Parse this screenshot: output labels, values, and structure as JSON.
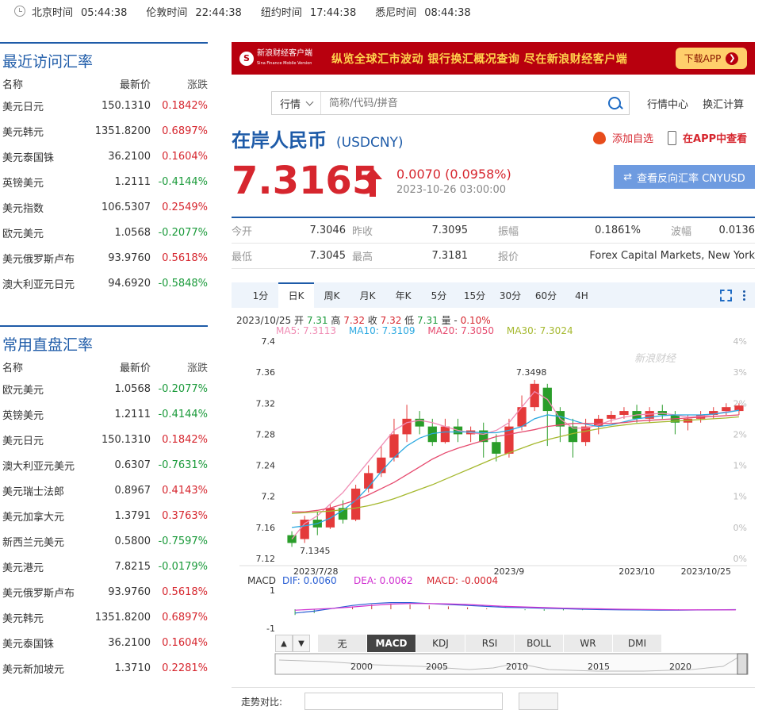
{
  "clocks": [
    {
      "city": "北京时间",
      "time": "05:44:38"
    },
    {
      "city": "伦敦时间",
      "time": "22:44:38"
    },
    {
      "city": "纽约时间",
      "time": "17:44:38"
    },
    {
      "city": "悉尼时间",
      "time": "08:44:38"
    }
  ],
  "recent": {
    "title": "最近访问汇率",
    "header": {
      "name": "名称",
      "price": "最新价",
      "change": "涨跌"
    },
    "rows": [
      {
        "name": "美元日元",
        "price": "150.1310",
        "change": "0.1842%",
        "dir": "up"
      },
      {
        "name": "美元韩元",
        "price": "1351.8200",
        "change": "0.6897%",
        "dir": "up"
      },
      {
        "name": "美元泰国铢",
        "price": "36.2100",
        "change": "0.1604%",
        "dir": "up"
      },
      {
        "name": "英镑美元",
        "price": "1.2111",
        "change": "-0.4144%",
        "dir": "down"
      },
      {
        "name": "美元指数",
        "price": "106.5307",
        "change": "0.2549%",
        "dir": "up"
      },
      {
        "name": "欧元美元",
        "price": "1.0568",
        "change": "-0.2077%",
        "dir": "down"
      },
      {
        "name": "美元俄罗斯卢布",
        "price": "93.9760",
        "change": "0.5618%",
        "dir": "up"
      },
      {
        "name": "澳大利亚元日元",
        "price": "94.6920",
        "change": "-0.5848%",
        "dir": "down"
      }
    ]
  },
  "common": {
    "title": "常用直盘汇率",
    "header": {
      "name": "名称",
      "price": "最新价",
      "change": "涨跌"
    },
    "rows": [
      {
        "name": "欧元美元",
        "price": "1.0568",
        "change": "-0.2077%",
        "dir": "down"
      },
      {
        "name": "英镑美元",
        "price": "1.2111",
        "change": "-0.4144%",
        "dir": "down"
      },
      {
        "name": "美元日元",
        "price": "150.1310",
        "change": "0.1842%",
        "dir": "up"
      },
      {
        "name": "澳大利亚元美元",
        "price": "0.6307",
        "change": "-0.7631%",
        "dir": "down"
      },
      {
        "name": "美元瑞士法郎",
        "price": "0.8967",
        "change": "0.4143%",
        "dir": "up"
      },
      {
        "name": "美元加拿大元",
        "price": "1.3791",
        "change": "0.3763%",
        "dir": "up"
      },
      {
        "name": "新西兰元美元",
        "price": "0.5800",
        "change": "-0.7597%",
        "dir": "down"
      },
      {
        "name": "美元港元",
        "price": "7.8215",
        "change": "-0.0179%",
        "dir": "down"
      },
      {
        "name": "美元俄罗斯卢布",
        "price": "93.9760",
        "change": "0.5618%",
        "dir": "up"
      },
      {
        "name": "美元韩元",
        "price": "1351.8200",
        "change": "0.6897%",
        "dir": "up"
      },
      {
        "name": "美元泰国铢",
        "price": "36.2100",
        "change": "0.1604%",
        "dir": "up"
      },
      {
        "name": "美元新加坡元",
        "price": "1.3710",
        "change": "0.2281%",
        "dir": "up"
      }
    ]
  },
  "banner": {
    "logo_text": "新浪财经客户端",
    "logo_sub": "Sina Finance Mobile Version",
    "slogan": "纵览全球汇市波动  银行换汇概况查询  尽在新浪财经客户端",
    "download": "下载APP"
  },
  "search": {
    "select": "行情",
    "placeholder": "简称/代码/拼音"
  },
  "toplinks": [
    "行情中心",
    "换汇计算"
  ],
  "symbol": {
    "name": "在岸人民币",
    "code": "(USDCNY)"
  },
  "actions": {
    "watch": "添加自选",
    "app": "在APP中查看"
  },
  "quote": {
    "price": "7.3165",
    "change": "0.0070 (0.0958%)",
    "time": "2023-10-26 03:00:00",
    "reverse_btn": "查看反向汇率 CNYUSD",
    "up_color": "#d6262e"
  },
  "stats": {
    "open_label": "今开",
    "open": "7.3046",
    "prev_label": "昨收",
    "prev": "7.3095",
    "amp_label": "振幅",
    "amp": "0.1861%",
    "wave_label": "波幅",
    "wave": "0.0136",
    "low_label": "最低",
    "low": "7.3045",
    "high_label": "最高",
    "high": "7.3181",
    "source_label": "报价",
    "source": "Forex Capital Markets, New York"
  },
  "period_tabs": [
    "1分",
    "日K",
    "周K",
    "月K",
    "年K",
    "5分",
    "15分",
    "30分",
    "60分",
    "4H"
  ],
  "active_period": "日K",
  "chart_info": {
    "date": "2023/10/25",
    "open_label": "开",
    "open": "7.31",
    "high_label": "高",
    "high": "7.32",
    "close_label": "收",
    "close": "7.32",
    "low_label": "低",
    "low": "7.31",
    "vol_label": "量",
    "vol": "-",
    "pct": "0.10%"
  },
  "ma_info": [
    {
      "label": "MA5: 7.3113",
      "color": "#f08cb4"
    },
    {
      "label": "MA10: 7.3109",
      "color": "#2aa8e0"
    },
    {
      "label": "MA20: 7.3050",
      "color": "#e64a6e"
    },
    {
      "label": "MA30: 7.3024",
      "color": "#a5b82e"
    }
  ],
  "macd_info": {
    "label": "MACD",
    "dif": "DIF: 0.0060",
    "dea": "DEA: 0.0062",
    "macd": "MACD: -0.0004"
  },
  "indicator_tabs": [
    "无",
    "MACD",
    "KDJ",
    "RSI",
    "BOLL",
    "WR",
    "DMI"
  ],
  "active_indicator": "MACD",
  "navigator_years": [
    "2000",
    "2005",
    "2010",
    "2015",
    "2020"
  ],
  "bottom": {
    "label": "走势对比:",
    "placeholder": "简称/代码/拼音",
    "button": "比较"
  },
  "chart_data": {
    "type": "candlestick",
    "title": "在岸人民币 (USDCNY)",
    "y_ticks": [
      "7.4",
      "7.36",
      "7.32",
      "7.28",
      "7.24",
      "7.2",
      "7.16",
      "7.12"
    ],
    "ylim": [
      7.12,
      7.4
    ],
    "pct_ticks": [
      "4%",
      "3%",
      "2%",
      "2%",
      "1%",
      "1%",
      "0%",
      "0%"
    ],
    "x_ticks": [
      "2023/7/28",
      "2023/9",
      "2023/10",
      "2023/10/25"
    ],
    "annotations": [
      {
        "label": "7.3498",
        "value": 7.3498
      },
      {
        "label": "7.1345",
        "value": 7.1345
      }
    ],
    "watermark": "新浪财经",
    "series": [
      {
        "name": "MA5",
        "color": "#f08cb4",
        "values": [
          7.145,
          7.165,
          7.175,
          7.19,
          7.205,
          7.225,
          7.245,
          7.265,
          7.285,
          7.295,
          7.298,
          7.295,
          7.29,
          7.285,
          7.282,
          7.28,
          7.285,
          7.295,
          7.315,
          7.335,
          7.325,
          7.3,
          7.288,
          7.288,
          7.292,
          7.298,
          7.302,
          7.305,
          7.306,
          7.307,
          7.305,
          7.302,
          7.303,
          7.306,
          7.309,
          7.311
        ]
      },
      {
        "name": "MA10",
        "color": "#2aa8e0",
        "values": [
          7.16,
          7.162,
          7.165,
          7.172,
          7.182,
          7.195,
          7.212,
          7.232,
          7.25,
          7.265,
          7.275,
          7.281,
          7.283,
          7.283,
          7.283,
          7.282,
          7.282,
          7.285,
          7.29,
          7.3,
          7.305,
          7.303,
          7.298,
          7.293,
          7.29,
          7.292,
          7.296,
          7.3,
          7.302,
          7.304,
          7.305,
          7.305,
          7.305,
          7.306,
          7.308,
          7.3109
        ]
      },
      {
        "name": "MA20",
        "color": "#e64a6e",
        "values": [
          7.18,
          7.18,
          7.182,
          7.185,
          7.19,
          7.195,
          7.202,
          7.21,
          7.218,
          7.228,
          7.238,
          7.248,
          7.256,
          7.262,
          7.267,
          7.272,
          7.277,
          7.28,
          7.283,
          7.286,
          7.29,
          7.292,
          7.294,
          7.294,
          7.294,
          7.294,
          7.295,
          7.297,
          7.298,
          7.299,
          7.3,
          7.301,
          7.302,
          7.303,
          7.304,
          7.305
        ]
      },
      {
        "name": "MA30",
        "color": "#a5b82e",
        "values": [
          7.178,
          7.179,
          7.18,
          7.181,
          7.183,
          7.185,
          7.188,
          7.192,
          7.197,
          7.203,
          7.209,
          7.215,
          7.222,
          7.229,
          7.236,
          7.243,
          7.25,
          7.256,
          7.262,
          7.268,
          7.273,
          7.277,
          7.281,
          7.284,
          7.287,
          7.29,
          7.292,
          7.294,
          7.295,
          7.296,
          7.297,
          7.298,
          7.299,
          7.3,
          7.301,
          7.3024
        ]
      }
    ],
    "candles": [
      [
        7.15,
        7.14,
        7.155,
        7.135
      ],
      [
        7.145,
        7.17,
        7.175,
        7.14
      ],
      [
        7.17,
        7.16,
        7.18,
        7.15
      ],
      [
        7.16,
        7.185,
        7.19,
        7.158
      ],
      [
        7.185,
        7.17,
        7.195,
        7.165
      ],
      [
        7.17,
        7.21,
        7.215,
        7.168
      ],
      [
        7.21,
        7.23,
        7.24,
        7.205
      ],
      [
        7.23,
        7.25,
        7.265,
        7.225
      ],
      [
        7.25,
        7.28,
        7.3,
        7.245
      ],
      [
        7.28,
        7.3,
        7.318,
        7.27
      ],
      [
        7.3,
        7.29,
        7.31,
        7.28
      ],
      [
        7.29,
        7.27,
        7.3,
        7.265
      ],
      [
        7.27,
        7.29,
        7.3,
        7.268
      ],
      [
        7.29,
        7.28,
        7.3,
        7.27
      ],
      [
        7.28,
        7.285,
        7.29,
        7.27
      ],
      [
        7.285,
        7.27,
        7.295,
        7.25
      ],
      [
        7.27,
        7.255,
        7.28,
        7.245
      ],
      [
        7.255,
        7.29,
        7.3,
        7.25
      ],
      [
        7.29,
        7.315,
        7.33,
        7.285
      ],
      [
        7.315,
        7.345,
        7.35,
        7.31
      ],
      [
        7.34,
        7.31,
        7.345,
        7.265
      ],
      [
        7.31,
        7.29,
        7.315,
        7.27
      ],
      [
        7.29,
        7.27,
        7.3,
        7.25
      ],
      [
        7.27,
        7.29,
        7.3,
        7.265
      ],
      [
        7.29,
        7.3,
        7.305,
        7.28
      ],
      [
        7.3,
        7.305,
        7.31,
        7.295
      ],
      [
        7.305,
        7.31,
        7.315,
        7.3
      ],
      [
        7.31,
        7.3,
        7.318,
        7.295
      ],
      [
        7.3,
        7.31,
        7.315,
        7.295
      ],
      [
        7.31,
        7.305,
        7.318,
        7.3
      ],
      [
        7.305,
        7.295,
        7.31,
        7.28
      ],
      [
        7.295,
        7.3,
        7.305,
        7.285
      ],
      [
        7.3,
        7.305,
        7.31,
        7.295
      ],
      [
        7.305,
        7.31,
        7.315,
        7.3
      ],
      [
        7.31,
        7.315,
        7.32,
        7.305
      ],
      [
        7.31,
        7.317,
        7.32,
        7.305
      ]
    ],
    "candle_fields": [
      "open",
      "close",
      "high",
      "low"
    ],
    "macd": {
      "ylim": [
        -1,
        1
      ],
      "y_ticks": [
        "1",
        "-1"
      ],
      "dif_color": "#2a5fd4",
      "dea_color": "#d02fd0",
      "dif": [
        -0.2,
        -0.1,
        0.05,
        0.2,
        0.3,
        0.35,
        0.35,
        0.3,
        0.25,
        0.2,
        0.15,
        0.1,
        0.08,
        0.05,
        0.03,
        0.0,
        -0.02,
        -0.03,
        -0.04,
        -0.05,
        -0.05,
        -0.04,
        -0.03,
        -0.02
      ],
      "dea": [
        -0.05,
        0.0,
        0.05,
        0.12,
        0.2,
        0.27,
        0.3,
        0.3,
        0.28,
        0.25,
        0.2,
        0.15,
        0.12,
        0.09,
        0.06,
        0.04,
        0.02,
        0.0,
        -0.01,
        -0.02,
        -0.03,
        -0.03,
        -0.03,
        -0.03
      ],
      "hist": [
        -0.3,
        -0.2,
        0.0,
        0.15,
        0.25,
        0.3,
        0.25,
        0.2,
        0.15,
        0.1,
        0.05,
        0.0,
        -0.05,
        -0.08,
        -0.06,
        -0.05,
        -0.04,
        -0.03,
        -0.03,
        -0.02,
        -0.02,
        -0.01,
        0.0,
        -0.01
      ]
    }
  }
}
